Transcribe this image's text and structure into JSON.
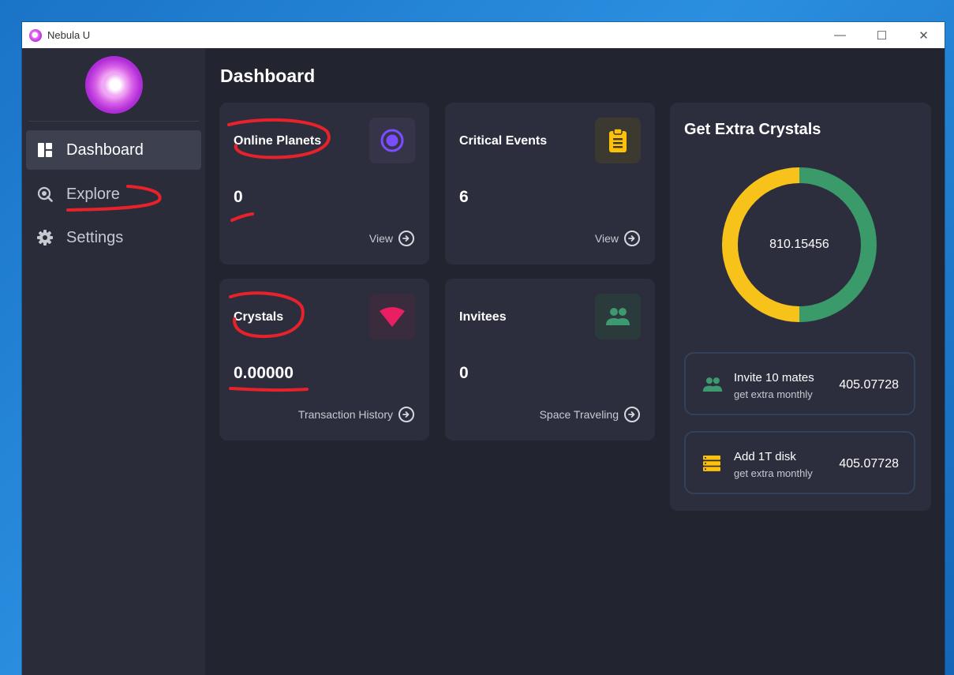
{
  "window": {
    "title": "Nebula U",
    "controls": {
      "minimize": "—",
      "maximize": "☐",
      "close": "✕"
    }
  },
  "sidebar": {
    "items": [
      {
        "label": "Dashboard",
        "icon": "dashboard-icon",
        "active": true
      },
      {
        "label": "Explore",
        "icon": "explore-icon",
        "active": false
      },
      {
        "label": "Settings",
        "icon": "settings-icon",
        "active": false
      }
    ]
  },
  "main": {
    "title": "Dashboard",
    "cards": [
      {
        "title": "Online Planets",
        "value": "0",
        "link": "View",
        "icon": "target-icon",
        "icon_color": "#7c4dff"
      },
      {
        "title": "Critical Events",
        "value": "6",
        "link": "View",
        "icon": "clipboard-icon",
        "icon_color": "#ffc107"
      },
      {
        "title": "Crystals",
        "value": "0.00000",
        "link": "Transaction History",
        "icon": "wifi-wedge-icon",
        "icon_color": "#e91e63"
      },
      {
        "title": "Invitees",
        "value": "0",
        "link": "Space Traveling",
        "icon": "group-icon",
        "icon_color": "#3d9970"
      }
    ]
  },
  "extra": {
    "title": "Get Extra Crystals",
    "total": "810.15456",
    "chart_data": {
      "type": "pie",
      "categories": [
        "Invite 10 mates",
        "Add 1T disk"
      ],
      "values": [
        405.07728,
        405.07728
      ],
      "colors": [
        "#3a9a6a",
        "#f7c21a"
      ]
    },
    "offers": [
      {
        "title": "Invite 10 mates",
        "subtitle": "get extra monthly",
        "value": "405.07728",
        "icon": "group-icon",
        "icon_color": "#3d9970"
      },
      {
        "title": "Add 1T disk",
        "subtitle": "get extra monthly",
        "value": "405.07728",
        "icon": "storage-icon",
        "icon_color": "#ffc107"
      }
    ]
  },
  "colors": {
    "background": "#22242f",
    "sidebar": "#2a2c3a",
    "card": "#2c2e3d",
    "annotation": "#e8222a"
  }
}
